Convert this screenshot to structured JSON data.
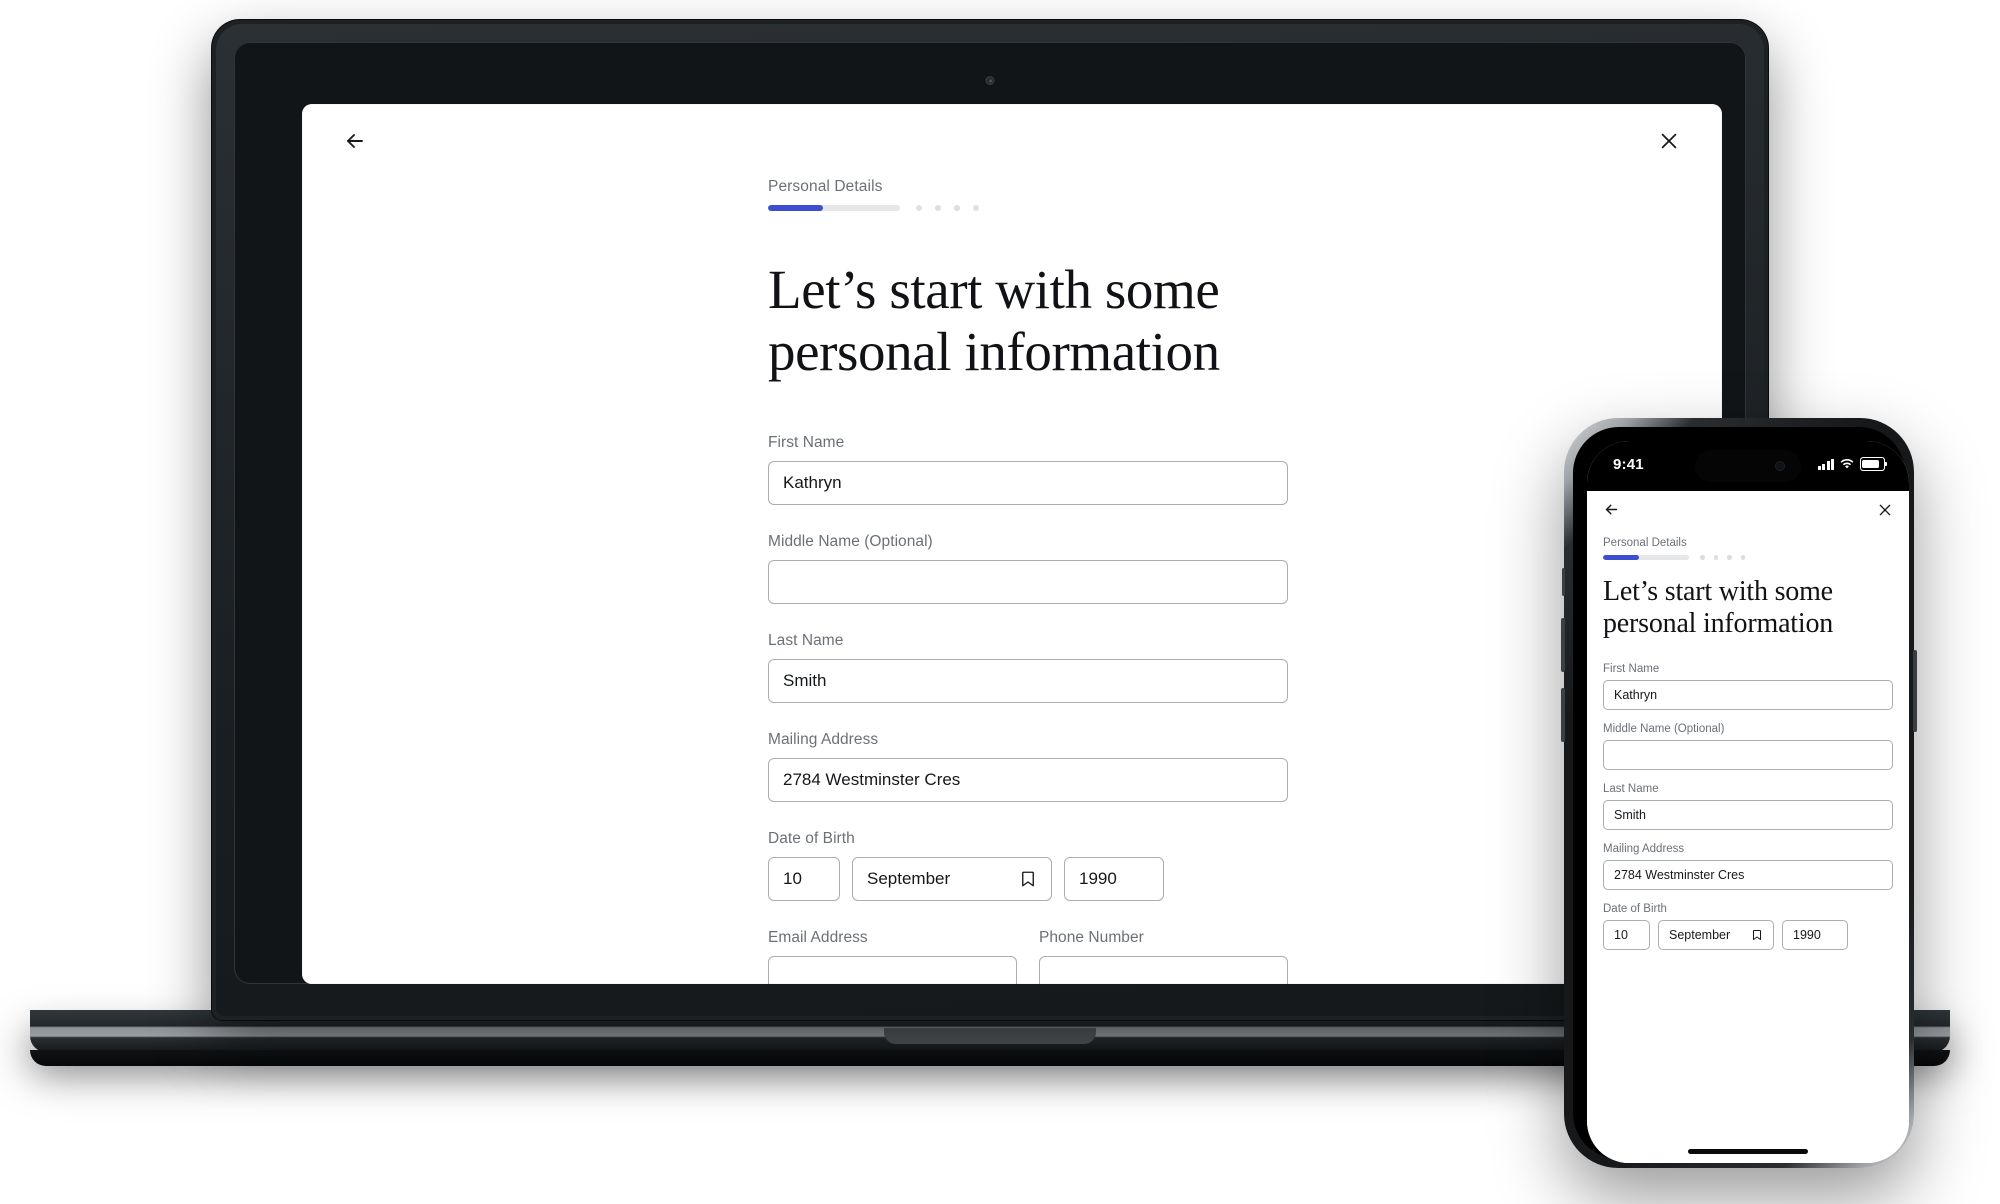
{
  "accent_color": "#3b4fd0",
  "app": {
    "back_icon": "arrow-left-icon",
    "close_icon": "close-icon",
    "step_label": "Personal Details",
    "progress": {
      "percent": 42,
      "dots": 4
    },
    "headline": "Let’s start with some personal information",
    "headline_phone": "Let’s start with some personal information"
  },
  "form": {
    "fields": [
      {
        "label": "First Name",
        "value": "Kathryn",
        "placeholder": ""
      },
      {
        "label": "Middle Name (Optional)",
        "value": "",
        "placeholder": ""
      },
      {
        "label": "Last Name",
        "value": "Smith",
        "placeholder": ""
      },
      {
        "label": "Mailing Address",
        "value": "2784 Westminster Cres",
        "placeholder": ""
      }
    ],
    "dob": {
      "label": "Date of Birth",
      "day": "10",
      "month": "September",
      "year": "1990",
      "month_icon": "bookmark-icon"
    },
    "contact": [
      {
        "label": "Email Address",
        "value": "",
        "placeholder": ""
      },
      {
        "label": "Phone Number",
        "value": "",
        "placeholder": ""
      }
    ]
  },
  "phone": {
    "status": {
      "time": "9:41",
      "signal_icon": "cellular-signal-icon",
      "wifi_icon": "wifi-icon",
      "battery_icon": "battery-icon"
    }
  }
}
